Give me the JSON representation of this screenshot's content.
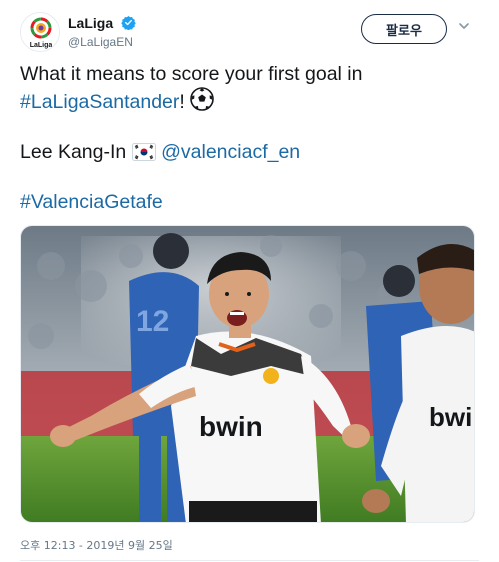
{
  "account": {
    "display_name": "LaLiga",
    "handle": "@LaLigaEN",
    "avatar_label": "LaLiga",
    "verified_icon": "verified-badge-icon"
  },
  "actions": {
    "follow_label": "팔로우",
    "more_icon": "chevron-down-icon"
  },
  "tweet": {
    "line1_text": "What it means to score your first goal in",
    "line2_hashtag": "#LaLigaSantander",
    "line2_suffix": "!",
    "line2_emoji": "soccer-ball-icon",
    "player_name": "Lee Kang-In",
    "flag_emoji": "south-korea-flag-icon",
    "mention": "@valenciacf_en",
    "hashtag2": "#ValenciaGetafe"
  },
  "media": {
    "sponsor_text_main": "bwin",
    "sponsor_text_right": "bwin",
    "shirt_number": "12"
  },
  "timestamp": "오후 12:13 - 2019년 9월 25일",
  "colors": {
    "link": "#1b6aa5",
    "text": "#14171a",
    "secondary": "#657786",
    "button_border": "#1a2c46",
    "verified": "#1da1f2"
  }
}
